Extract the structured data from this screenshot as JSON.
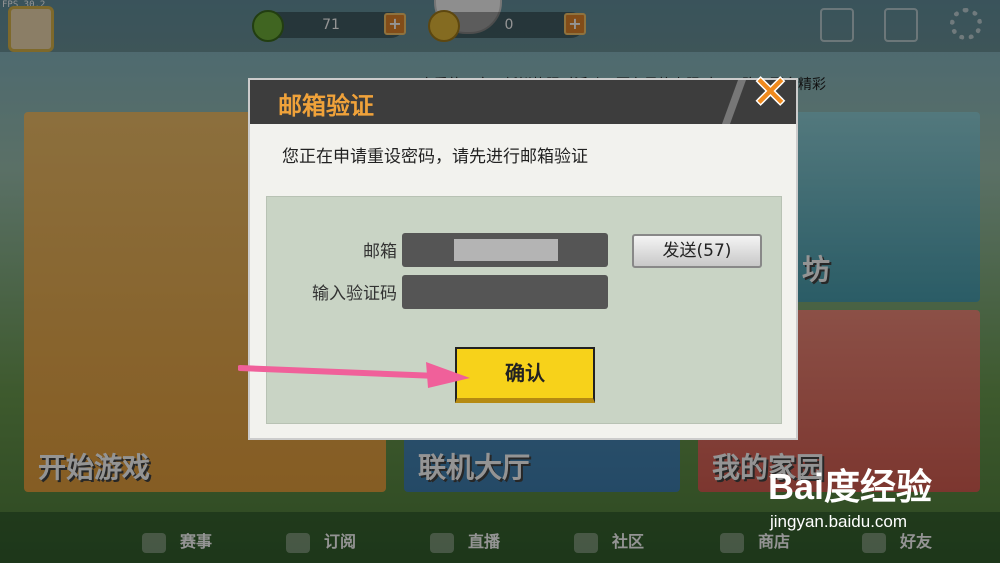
{
  "fps": "FPS 30.2",
  "topbar": {
    "gems": "71",
    "coins": "0",
    "plus": "+"
  },
  "marquee": "亲爱的玩家：新鲜热限时活动，更在风格上限时一元购！更多精彩",
  "cards": {
    "start": "开始游戏",
    "lobby": "联机大厅",
    "home": "我的家园",
    "workshop": "坊"
  },
  "nav": {
    "items": [
      "赛事",
      "订阅",
      "直播",
      "社区",
      "商店",
      "好友"
    ]
  },
  "dialog": {
    "title": "邮箱验证",
    "close_icon": "✕",
    "hint": "您正在申请重设密码，请先进行邮箱验证",
    "email_label": "邮箱",
    "code_label": "输入验证码",
    "send_label": "发送(57)",
    "confirm_label": "确认"
  },
  "watermark": {
    "logo": "Bai度经验",
    "url": "jingyan.baidu.com"
  },
  "colors": {
    "dialog_title": "#f0a23a",
    "confirm_bg": "#f7d21a",
    "arrow": "#f0609a"
  }
}
